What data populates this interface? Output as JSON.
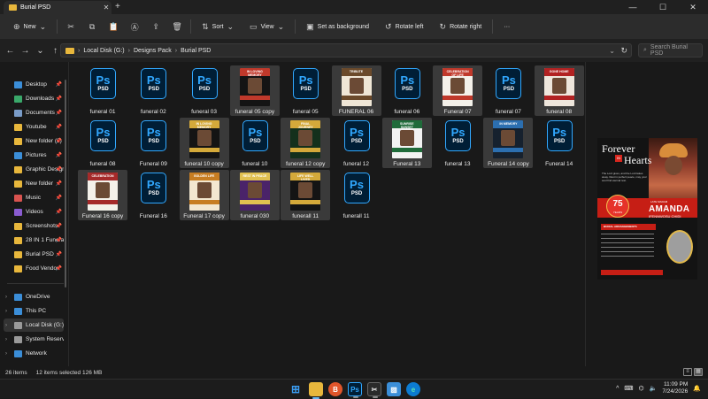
{
  "window": {
    "tab_title": "Burial PSD",
    "tab_close": "✕",
    "new_tab": "+",
    "minimize": "—",
    "maximize": "☐",
    "close": "✕"
  },
  "commandbar": {
    "new_label": "New",
    "sort_label": "Sort",
    "view_label": "View",
    "set_background_label": "Set as background",
    "rotate_left_label": "Rotate left",
    "rotate_right_label": "Rotate right",
    "more_label": "···"
  },
  "address": {
    "crumbs": [
      "Local Disk (G:)",
      "Designs Pack",
      "Burial PSD"
    ],
    "search_placeholder": "Search Burial PSD"
  },
  "sidebar": {
    "items": [
      {
        "label": "Desktop",
        "icon": "desktop-icon",
        "color": "#3b8ed8",
        "pinned": true
      },
      {
        "label": "Downloads",
        "icon": "downloads-icon",
        "color": "#3aa86a",
        "pinned": true
      },
      {
        "label": "Documents",
        "icon": "documents-icon",
        "color": "#7a9cc8",
        "pinned": true
      },
      {
        "label": "Youtube",
        "icon": "folder-icon",
        "color": "#e8b73c",
        "pinned": true
      },
      {
        "label": "New folder (3)",
        "icon": "folder-icon",
        "color": "#e8b73c",
        "pinned": true
      },
      {
        "label": "Pictures",
        "icon": "pictures-icon",
        "color": "#3b8ed8",
        "pinned": true
      },
      {
        "label": "Graphic Design",
        "icon": "folder-icon",
        "color": "#e8b73c",
        "pinned": true
      },
      {
        "label": "New folder",
        "icon": "folder-icon",
        "color": "#e8b73c",
        "pinned": true
      },
      {
        "label": "Music",
        "icon": "music-icon",
        "color": "#d9534f",
        "pinned": true
      },
      {
        "label": "Videos",
        "icon": "videos-icon",
        "color": "#8a5cd0",
        "pinned": true
      },
      {
        "label": "Screenshots",
        "icon": "folder-icon",
        "color": "#e8b73c",
        "pinned": true
      },
      {
        "label": "28 IN 1 Funeral",
        "icon": "folder-icon",
        "color": "#e8b73c",
        "pinned": true
      },
      {
        "label": "Burial PSD",
        "icon": "folder-icon",
        "color": "#e8b73c",
        "pinned": true
      },
      {
        "label": "Food Vendor",
        "icon": "folder-icon",
        "color": "#e8b73c",
        "pinned": true
      },
      {
        "label": "OneDrive",
        "icon": "onedrive-icon",
        "color": "#3b8ed8",
        "pinned": false
      },
      {
        "label": "This PC",
        "icon": "this-pc-icon",
        "color": "#3b8ed8",
        "pinned": false
      },
      {
        "label": "Local Disk (G:)",
        "icon": "drive-icon",
        "color": "#9a9a9a",
        "pinned": false
      },
      {
        "label": "System Reserved",
        "icon": "drive-icon",
        "color": "#9a9a9a",
        "pinned": false
      },
      {
        "label": "Network",
        "icon": "network-icon",
        "color": "#3b8ed8",
        "pinned": false
      }
    ]
  },
  "files": [
    {
      "label": "funeral 01",
      "kind": "psd",
      "selected": false
    },
    {
      "label": "funeral 02",
      "kind": "psd",
      "selected": false
    },
    {
      "label": "funeral 03",
      "kind": "psd",
      "selected": false
    },
    {
      "label": "funeral 05 copy",
      "kind": "thumb",
      "selected": true,
      "bg": "#141414",
      "band": "#c0392b",
      "title": "IN LOVING MEMORY"
    },
    {
      "label": "funeral 05",
      "kind": "psd",
      "selected": false
    },
    {
      "label": "FUNERAL 06",
      "kind": "thumb",
      "selected": true,
      "bg": "#efe6d6",
      "band": "#6b4a2b",
      "title": "TRIBUTE"
    },
    {
      "label": "funeral 06",
      "kind": "psd",
      "selected": false
    },
    {
      "label": "Funeral 07",
      "kind": "thumb",
      "selected": true,
      "bg": "#f4f1ea",
      "band": "#c0392b",
      "title": "CELEBRATION OF LIFE"
    },
    {
      "label": "funeral 07",
      "kind": "psd",
      "selected": false
    },
    {
      "label": "funeral 08",
      "kind": "thumb",
      "selected": true,
      "bg": "#eee6dc",
      "band": "#b22222",
      "title": "GONE HOME"
    },
    {
      "label": "funeral 08",
      "kind": "psd",
      "selected": false
    },
    {
      "label": "Funeral 09",
      "kind": "psd",
      "selected": false
    },
    {
      "label": "funeral 10 copy",
      "kind": "thumb",
      "selected": true,
      "bg": "#141414",
      "band": "#d4a93a",
      "title": "IN LOVING MEMORY"
    },
    {
      "label": "funeral 10",
      "kind": "psd",
      "selected": false
    },
    {
      "label": "funeral 12 copy",
      "kind": "thumb",
      "selected": true,
      "bg": "#14301c",
      "band": "#d4a93a",
      "title": "FINAL JOURNEY"
    },
    {
      "label": "funeral 12",
      "kind": "psd",
      "selected": false
    },
    {
      "label": "Funeral 13",
      "kind": "thumb",
      "selected": true,
      "bg": "#f2f2f2",
      "band": "#1f6b3a",
      "title": "SUNRISE SUNSET"
    },
    {
      "label": "funeral 13",
      "kind": "psd",
      "selected": false
    },
    {
      "label": "Funeral 14 copy",
      "kind": "thumb",
      "selected": true,
      "bg": "#16212e",
      "band": "#2c6fb0",
      "title": "IN MEMORY"
    },
    {
      "label": "Funeral 14",
      "kind": "psd",
      "selected": false
    },
    {
      "label": "Funeral 16 copy",
      "kind": "thumb",
      "selected": true,
      "bg": "#f4f1ea",
      "band": "#a52a2a",
      "title": "CELEBRATION"
    },
    {
      "label": "Funeral 16",
      "kind": "psd",
      "selected": false
    },
    {
      "label": "Funeral 17 copy",
      "kind": "thumb",
      "selected": true,
      "bg": "#f3e7d0",
      "band": "#c77d22",
      "title": "GOLDEN LIFE"
    },
    {
      "label": "funeral 030",
      "kind": "thumb",
      "selected": true,
      "bg": "#4a2369",
      "band": "#e0c050",
      "title": "REST IN PEACE"
    },
    {
      "label": "funerall 11",
      "kind": "thumb",
      "selected": true,
      "bg": "#141414",
      "band": "#d4a93a",
      "title": "LIFE WELL LIVED"
    },
    {
      "label": "funerall 11",
      "kind": "psd",
      "selected": false
    }
  ],
  "preview": {
    "line1": "Forever",
    "line2": "Hearts",
    "tag": "IN",
    "blurb": "The Lord gives, and the Lord takes away. Rest in perfect peace, may your soul find eternal rest.",
    "age": "75",
    "age_unit": "YEARS",
    "late_label": "LATE MADAM",
    "first_name": "AMANDA",
    "surname": "IFENNWOSU CHIDI",
    "burial_label": "BURIAL ARRANGEMENTS"
  },
  "status": {
    "item_count": "26 items",
    "selection": "12 items selected  126 MB"
  },
  "taskbar": {
    "time": "11:09 PM",
    "date": "7/24/2026",
    "tray_arrow": "^"
  },
  "colors": {
    "accent": "#31a8ff",
    "folder": "#e8b73c",
    "poster_red": "#c61e15"
  }
}
